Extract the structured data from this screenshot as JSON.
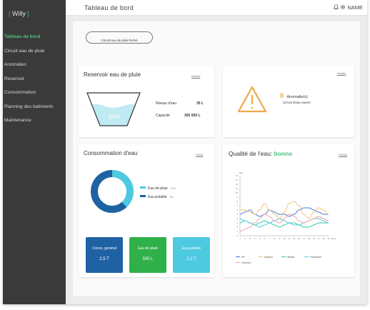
{
  "app": {
    "user": "Willy"
  },
  "sidebar": {
    "items": [
      {
        "label": "Tableau de bord",
        "active": true
      },
      {
        "label": "Circuit eau de pluie",
        "active": false
      },
      {
        "label": "Anomalies",
        "active": false
      },
      {
        "label": "Reservoir",
        "active": false
      },
      {
        "label": "Consommation",
        "active": false
      },
      {
        "label": "Planning des batiments",
        "active": false
      },
      {
        "label": "Maintenance",
        "active": false
      }
    ]
  },
  "header": {
    "title": "Tableau de bord",
    "user_label": "NAME",
    "icons": [
      "bell-icon",
      "gear-icon"
    ]
  },
  "circuit_button": {
    "label": "Circuit eau de pluie fermé"
  },
  "reservoir": {
    "title": "Reservoir eau de pluie",
    "details_label": "Details",
    "fill_percent_label": "60%",
    "fill_fraction": 0.6,
    "level_label": "Niveau d'eau",
    "level_value": "35 L",
    "capacity_label": "Capacité",
    "capacity_value": "300 000 L"
  },
  "anomalies": {
    "details_label": "Détails",
    "count": "0",
    "count_label": "Anomalie(s)",
    "status": "Circuit d'eau ouvert",
    "warning_color": "#f0a84a"
  },
  "consommation": {
    "title": "Consommation d'eau",
    "details_label": "Detail",
    "donut": [
      {
        "label": "Eau de pluie",
        "pct_label": "12%",
        "color": "#4dc9e0",
        "fraction": 0.38
      },
      {
        "label": "Eau potable",
        "pct_label": "6%",
        "color": "#1f62a3",
        "fraction": 0.62
      }
    ],
    "kpis": [
      {
        "label": "Conso. general",
        "value": "2,5 T",
        "color": "#1f62a3"
      },
      {
        "label": "Eau de pluie",
        "value": "500 L",
        "color": "#30b04a"
      },
      {
        "label": "Eau potable",
        "value": "2,2 T",
        "color": "#4dc9e0"
      }
    ]
  },
  "qualite": {
    "title_prefix": "Qualité de l'eau:",
    "title_status": "bonne",
    "status_color": "#4ec27e",
    "details_label": "Détails"
  },
  "chart_data": {
    "type": "line",
    "ylabel": "mg/L",
    "xlabel": "Jours",
    "x": [
      1,
      2,
      3,
      4,
      5,
      6,
      7,
      8,
      9,
      10,
      11,
      12,
      13,
      14,
      15,
      16,
      17,
      18,
      19
    ],
    "ylim": [
      0,
      14
    ],
    "y_ticks": [
      0,
      1,
      2,
      3,
      4,
      5,
      6,
      7,
      8,
      9,
      10,
      11,
      12,
      13,
      14
    ],
    "series": [
      {
        "name": "PH",
        "color": "#3a7bd5",
        "values": [
          5,
          5.5,
          6,
          5,
          4.5,
          5,
          6,
          5.5,
          5,
          5,
          4.5,
          5,
          6,
          6.5,
          6.5,
          6,
          5.5,
          5,
          5
        ]
      },
      {
        "name": "Sodium",
        "color": "#f2c27a",
        "values": [
          6,
          6,
          5.5,
          5,
          6,
          7.5,
          6,
          5,
          4,
          5.5,
          7.5,
          8,
          7,
          5,
          4,
          5.5,
          6.5,
          6,
          5
        ]
      },
      {
        "name": "Nitrate",
        "color": "#2ec9a0",
        "values": [
          3,
          3.5,
          3,
          2.5,
          3,
          3.5,
          3,
          2.5,
          2,
          2.5,
          3,
          3,
          2.5,
          2,
          2,
          2.5,
          3,
          3,
          3
        ]
      },
      {
        "name": "Potassium",
        "color": "#4dc9e0",
        "values": [
          4,
          3.5,
          3,
          2.5,
          2,
          2.5,
          3,
          3.5,
          4,
          3.5,
          3,
          2.5,
          2.5,
          3,
          3.5,
          4,
          4,
          3.5,
          3
        ]
      },
      {
        "name": "Chlorure",
        "color": "#f2a0a0",
        "values": [
          1,
          1.5,
          2,
          3,
          4,
          5,
          4.5,
          3.5,
          3,
          4,
          5,
          4.5,
          3.5,
          3,
          3.5,
          4,
          4.5,
          4,
          3.5
        ]
      }
    ]
  }
}
